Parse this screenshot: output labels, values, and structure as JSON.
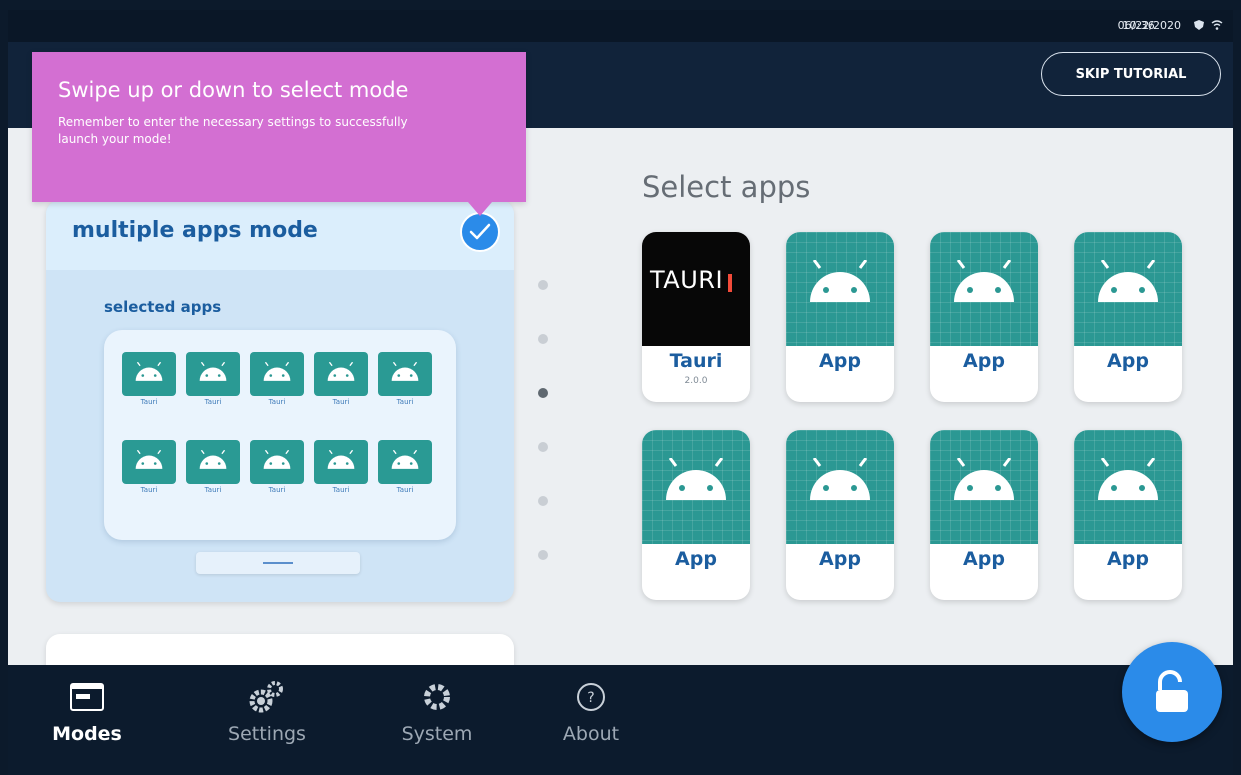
{
  "status": {
    "time": "10:36",
    "date": "06/22/2020",
    "icons": [
      "shield-icon",
      "wifi-icon"
    ]
  },
  "header": {
    "skip_label": "SKIP TUTORIAL"
  },
  "tooltip": {
    "title": "Swipe up or down to select mode",
    "body": "Remember to enter the necessary settings to successfully launch your mode!"
  },
  "mode_card": {
    "title": "multiple apps mode",
    "selected_title": "selected apps",
    "mini_apps": [
      {
        "label": "Tauri"
      },
      {
        "label": "Tauri"
      },
      {
        "label": "Tauri"
      },
      {
        "label": "Tauri"
      },
      {
        "label": "Tauri"
      },
      {
        "label": "Tauri"
      },
      {
        "label": "Tauri"
      },
      {
        "label": "Tauri"
      },
      {
        "label": "Tauri"
      },
      {
        "label": "Tauri"
      }
    ]
  },
  "pager": {
    "count": 6,
    "active_index": 2
  },
  "apps_panel": {
    "title": "Select apps",
    "apps": [
      {
        "label": "Tauri",
        "version": "2.0.0",
        "type": "tauri"
      },
      {
        "label": "App",
        "type": "android"
      },
      {
        "label": "App",
        "type": "android"
      },
      {
        "label": "App",
        "type": "android"
      },
      {
        "label": "App",
        "type": "android"
      },
      {
        "label": "App",
        "type": "android"
      },
      {
        "label": "App",
        "type": "android"
      },
      {
        "label": "App",
        "type": "android"
      }
    ],
    "tauri_logo_text": "TAURI"
  },
  "tabs": [
    {
      "label": "Modes",
      "icon": "modes-icon",
      "active": true
    },
    {
      "label": "Settings",
      "icon": "gears-icon",
      "active": false
    },
    {
      "label": "System",
      "icon": "gear-icon",
      "active": false
    },
    {
      "label": "About",
      "icon": "question-icon",
      "active": false
    }
  ],
  "colors": {
    "accent_blue": "#2b8be9",
    "tooltip_pink": "#d36fd2",
    "app_teal": "#2b9893",
    "title_blue": "#1b5d9f"
  }
}
